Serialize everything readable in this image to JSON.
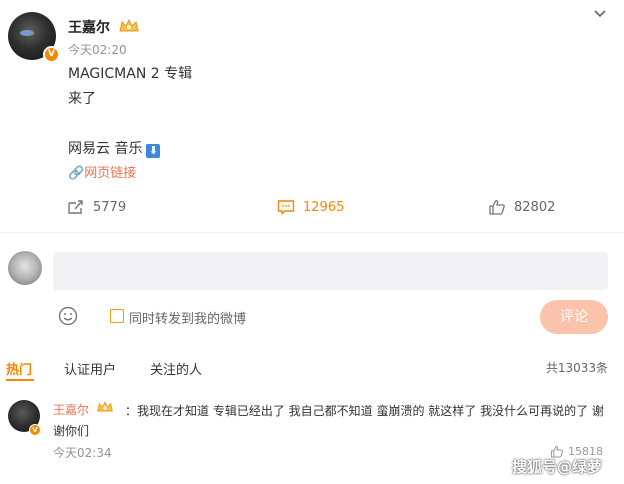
{
  "post": {
    "author": "王嘉尔",
    "time": "今天02:20",
    "lines": [
      "MAGICMAN 2 专辑",
      "来了",
      "网易云 音乐"
    ],
    "link_label": "网页链接",
    "stats": {
      "reposts": "5779",
      "comments": "12965",
      "likes": "82802"
    },
    "verified_mark": "V"
  },
  "composer": {
    "placeholder": "",
    "repost_label": "同时转发到我的微博",
    "submit_label": "评论"
  },
  "tabs": [
    {
      "label": "热门"
    },
    {
      "label": "认证用户"
    },
    {
      "label": "关注的人"
    }
  ],
  "total_label": "共13033条",
  "comment": {
    "author": "王嘉尔",
    "text": "：我现在才知道 专辑已经出了 我自己都不知道 蛮崩溃的 就这样了 我没什么可再说的了 谢谢你们",
    "time": "今天02:34",
    "likes": "15818"
  },
  "watermark": "搜狐号@绿萝",
  "colors": {
    "accent": "#ff8200",
    "link": "#eb7350",
    "button": "#fbc3ab"
  }
}
